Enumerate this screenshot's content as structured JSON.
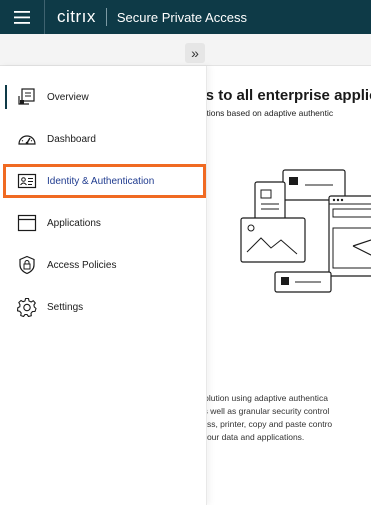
{
  "header": {
    "logo_text": "citrıx",
    "app_title": "Secure Private Access"
  },
  "colors": {
    "header_bg": "#0e3a47",
    "highlight_border": "#f06a22",
    "active_label": "#1f3b8f"
  },
  "sidebar": {
    "items": [
      {
        "label": "Overview",
        "icon": "overview-icon",
        "active": true
      },
      {
        "label": "Dashboard",
        "icon": "dashboard-gauge-icon"
      },
      {
        "label": "Identity & Authentication",
        "icon": "id-card-icon",
        "highlighted": true
      },
      {
        "label": "Applications",
        "icon": "application-window-icon"
      },
      {
        "label": "Access Policies",
        "icon": "lock-shield-icon"
      },
      {
        "label": "Settings",
        "icon": "gear-icon"
      }
    ]
  },
  "main": {
    "headline": "ess to all enterprise applic",
    "subline": "plications based on adaptive authentic",
    "description_lines": [
      "ss solution using adaptive authentica",
      "re as well as granular security control",
      "access, printer, copy and paste contro",
      "ect your data and applications."
    ]
  }
}
